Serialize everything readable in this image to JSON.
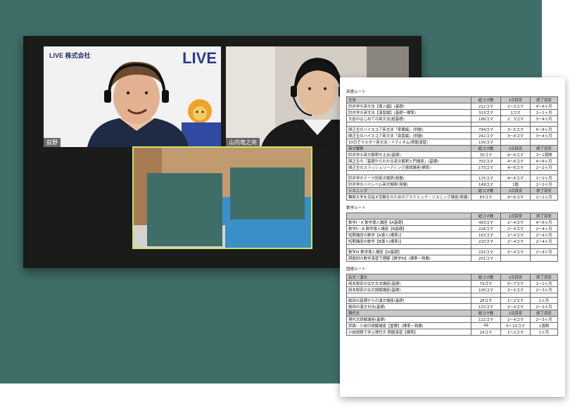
{
  "call": {
    "company_label": "LIVE 株式会社",
    "logo_text": "LIVE",
    "participants": [
      {
        "name": "荻野"
      },
      {
        "name": "山内竜之亮"
      }
    ]
  },
  "document": {
    "sections": [
      {
        "title": "英語ルート",
        "rows": [
          {
            "type": "header",
            "cells": [
              "文法",
              "総コマ数",
              "1日目安",
              "終了目安"
            ]
          },
          {
            "cells": [
              "肘井学の英文法【導入編】(基礎)",
              "212コマ",
              "2〜3コマ",
              "4〜6ヶ月"
            ]
          },
          {
            "cells": [
              "肘井学の英文法【演習編】(基礎〜標準)",
              "313コマ",
              "1コマ",
              "1〜2ヶ月"
            ]
          },
          {
            "cells": [
              "大岩のはじめての英文法(超基礎)",
              "188コマ",
              "2、3コマ",
              "3〜4ヶ月"
            ]
          },
          {
            "type": "gap",
            "cells": [
              "",
              "",
              "",
              ""
            ]
          },
          {
            "cells": [
              "関正生のハイスコア英文法「準備編」(例題)",
              "794コマ",
              "3〜5コマ",
              "6〜8ヶ月"
            ]
          },
          {
            "cells": [
              "関正生のハイスコア英文法「演習編」(例題)",
              "242コマ",
              "3〜4コマ",
              "3〜4ヶ月"
            ]
          },
          {
            "cells": [
              "10日でマスター英文法・イディオム(問題演習)",
              "130コマ",
              "",
              ""
            ]
          },
          {
            "type": "header",
            "cells": [
              "英文解釈",
              "総コマ数",
              "1日目安",
              "終了目安"
            ]
          },
          {
            "cells": [
              "肘井学の英文解釈の土台(基礎)",
              "35コマ",
              "4〜6コマ",
              "1〜2週間"
            ]
          },
          {
            "cells": [
              "関正生の「基礎からわかる英文解釈入門講座」(基礎)",
              "702コマ",
              "4〜6コマ",
              "4〜6ヶ月"
            ]
          },
          {
            "cells": [
              "関正生のスラッシュリーディング速読講座(標準)",
              "173コマ",
              "4〜6コマ",
              "1〜2ヶ月"
            ]
          },
          {
            "type": "gap",
            "cells": [
              "",
              "",
              "",
              ""
            ]
          },
          {
            "cells": [
              "肘井学のテーマ別英文解釈(発展)",
              "115コマ",
              "4〜6コマ",
              "1〜2ヶ月"
            ]
          },
          {
            "cells": [
              "肘井学のハイレベル英文解釈(発展)",
              "149コマ",
              "1題",
              "1〜2ヶ月"
            ]
          },
          {
            "type": "header",
            "cells": [
              "リスニング",
              "総コマ数",
              "1日目安",
              "終了目安"
            ]
          },
          {
            "cells": [
              "難関大学を目指す受験生のためのアカデミック・リスニング講座(発展)",
              "83コマ",
              "4〜6コマ",
              "1〜2ヶ月"
            ]
          }
        ]
      },
      {
        "title": "数学ルート",
        "rows": [
          {
            "type": "header",
            "cells": [
              "",
              "総コマ数",
              "1日目安",
              "終了目安"
            ]
          },
          {
            "cells": [
              "数学I・A 数学導入講座【A基礎】",
              "493コマ",
              "2〜4コマ",
              "4〜6ヶ月"
            ]
          },
          {
            "cells": [
              "数学II・B 数学導入講座【B基礎】",
              "226コマ",
              "2〜4コマ",
              "2〜4ヶ月"
            ]
          },
          {
            "cells": [
              "短期講座の数学【A導入(標準)】",
              "163コマ",
              "2〜4コマ",
              "2〜4ヶ月"
            ]
          },
          {
            "cells": [
              "短期講座の数学【B導入(標準)】",
              "220コマ",
              "2〜4コマ",
              "2〜4ヶ月"
            ]
          },
          {
            "type": "gap",
            "cells": [
              "",
              "",
              "",
              ""
            ]
          },
          {
            "cells": [
              "数学III 数学導入講座【III基礎】",
              "231コマ",
              "2〜4コマ",
              "2〜4ヶ月"
            ]
          },
          {
            "cells": [
              "問題別の数学演習で理解【数学III】(標準〜発展)",
              "201コマ",
              "",
              ""
            ]
          }
        ]
      },
      {
        "title": "国語ルート",
        "rows": [
          {
            "type": "header",
            "cells": [
              "古文・漢文",
              "総コマ数",
              "1日目安",
              "終了目安"
            ]
          },
          {
            "cells": [
              "岡本梨奈の古文文法講座(基礎)",
              "79コマ",
              "5〜7コマ",
              "1〜2ヶ月"
            ]
          },
          {
            "cells": [
              "岡本梨奈の古文読解講座(基礎)",
              "100コマ",
              "2〜5コマ",
              "2〜3ヶ月"
            ]
          },
          {
            "type": "gap",
            "cells": [
              "",
              "",
              "",
              ""
            ]
          },
          {
            "cells": [
              "飯田の基礎からの漢文講座(基礎)",
              "26コマ",
              "1〜2コマ",
              "1ヶ月"
            ]
          },
          {
            "cells": [
              "飯田の漢文句法(基礎)",
              "133コマ",
              "2〜4コマ",
              "2〜3ヶ月"
            ]
          },
          {
            "type": "header",
            "cells": [
              "現代文",
              "総コマ数",
              "1日目安",
              "終了目安"
            ]
          },
          {
            "cells": [
              "現代文読解講座(基礎)",
              "122コマ",
              "2〜4コマ",
              "2〜3ヶ月"
            ]
          },
          {
            "cells": [
              "評論・小説の読解講座【重要】(標準〜発展)",
              "49",
              "5〜10コマ",
              "1週間"
            ]
          },
          {
            "cells": [
              "小説読解で学ぶ現代文 問題演習【標準】",
              "24コマ",
              "1〜2コマ",
              "1ヶ月"
            ]
          }
        ]
      }
    ]
  }
}
